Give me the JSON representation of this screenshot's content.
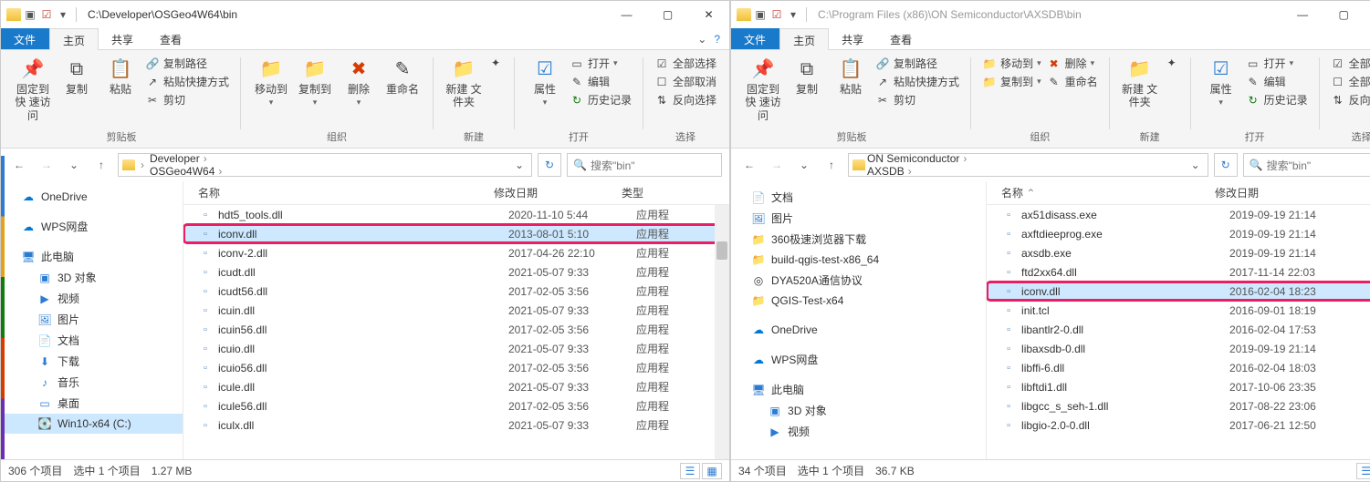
{
  "left": {
    "title": "C:\\Developer\\OSGeo4W64\\bin",
    "tabs": {
      "file": "文件",
      "home": "主页",
      "share": "共享",
      "view": "查看"
    },
    "ribbon": {
      "clip": {
        "pin": "固定到快\n速访问",
        "copy": "复制",
        "paste": "粘贴",
        "copypath": "复制路径",
        "pastesc": "粘贴快捷方式",
        "cut": "剪切",
        "group": "剪贴板"
      },
      "org": {
        "moveto": "移动到",
        "copyto": "复制到",
        "delete": "删除",
        "rename": "重命名",
        "group": "组织"
      },
      "new": {
        "newfolder": "新建\n文件夹",
        "group": "新建"
      },
      "open": {
        "props": "属性",
        "open": "打开",
        "edit": "编辑",
        "history": "历史记录",
        "group": "打开"
      },
      "select": {
        "all": "全部选择",
        "none": "全部取消",
        "invert": "反向选择",
        "group": "选择"
      }
    },
    "breadcrumbs": [
      "Win10-x64 (C:)",
      "Developer",
      "OSGeo4W64",
      "bin"
    ],
    "search_ph": "搜索\"bin\"",
    "nav": {
      "onedrive": "OneDrive",
      "wps": "WPS网盘",
      "thispc": "此电脑",
      "obj3d": "3D 对象",
      "videos": "视频",
      "pictures": "图片",
      "docs": "文档",
      "downloads": "下载",
      "music": "音乐",
      "desktop": "桌面",
      "cdrive": "Win10-x64 (C:)"
    },
    "cols": {
      "name": "名称",
      "date": "修改日期",
      "type": "类型"
    },
    "files": [
      {
        "n": "hdt5_tools.dll",
        "d": "2020-11-10 5:44",
        "t": "应用程"
      },
      {
        "n": "iconv.dll",
        "d": "2013-08-01 5:10",
        "t": "应用程",
        "sel": true,
        "hl": true
      },
      {
        "n": "iconv-2.dll",
        "d": "2017-04-26 22:10",
        "t": "应用程"
      },
      {
        "n": "icudt.dll",
        "d": "2021-05-07 9:33",
        "t": "应用程"
      },
      {
        "n": "icudt56.dll",
        "d": "2017-02-05 3:56",
        "t": "应用程"
      },
      {
        "n": "icuin.dll",
        "d": "2021-05-07 9:33",
        "t": "应用程"
      },
      {
        "n": "icuin56.dll",
        "d": "2017-02-05 3:56",
        "t": "应用程"
      },
      {
        "n": "icuio.dll",
        "d": "2021-05-07 9:33",
        "t": "应用程"
      },
      {
        "n": "icuio56.dll",
        "d": "2017-02-05 3:56",
        "t": "应用程"
      },
      {
        "n": "icule.dll",
        "d": "2021-05-07 9:33",
        "t": "应用程"
      },
      {
        "n": "icule56.dll",
        "d": "2017-02-05 3:56",
        "t": "应用程"
      },
      {
        "n": "iculx.dll",
        "d": "2021-05-07 9:33",
        "t": "应用程"
      }
    ],
    "status": {
      "count": "306 个项目",
      "sel": "选中 1 个项目",
      "size": "1.27 MB"
    }
  },
  "right": {
    "title": "C:\\Program Files (x86)\\ON Semiconductor\\AXSDB\\bin",
    "breadcrumbs": [
      "«",
      "ON Semiconductor",
      "AXSDB",
      "bin"
    ],
    "search_ph": "搜索\"bin\"",
    "nav": {
      "docs": "文档",
      "pictures": "图片",
      "dl360": "360极速浏览器下载",
      "buildqgis": "build-qgis-test-x86_64",
      "dya": "DYA520A通信协议",
      "qgistest": "QGIS-Test-x64",
      "onedrive": "OneDrive",
      "wps": "WPS网盘",
      "thispc": "此电脑",
      "obj3d": "3D 对象",
      "videos": "视频"
    },
    "cols": {
      "name": "名称",
      "date": "修改日期"
    },
    "files": [
      {
        "n": "ax51disass.exe",
        "d": "2019-09-19 21:14"
      },
      {
        "n": "axftdieeprog.exe",
        "d": "2019-09-19 21:14"
      },
      {
        "n": "axsdb.exe",
        "d": "2019-09-19 21:14"
      },
      {
        "n": "ftd2xx64.dll",
        "d": "2017-11-14 22:03"
      },
      {
        "n": "iconv.dll",
        "d": "2016-02-04 18:23",
        "sel": true,
        "hl": true
      },
      {
        "n": "init.tcl",
        "d": "2016-09-01 18:19"
      },
      {
        "n": "libantlr2-0.dll",
        "d": "2016-02-04 17:53"
      },
      {
        "n": "libaxsdb-0.dll",
        "d": "2019-09-19 21:14"
      },
      {
        "n": "libffi-6.dll",
        "d": "2016-02-04 18:03"
      },
      {
        "n": "libftdi1.dll",
        "d": "2017-10-06 23:35"
      },
      {
        "n": "libgcc_s_seh-1.dll",
        "d": "2017-08-22 23:06"
      },
      {
        "n": "libgio-2.0-0.dll",
        "d": "2017-06-21 12:50"
      }
    ],
    "status": {
      "count": "34 个项目",
      "sel": "选中 1 个项目",
      "size": "36.7 KB"
    }
  }
}
